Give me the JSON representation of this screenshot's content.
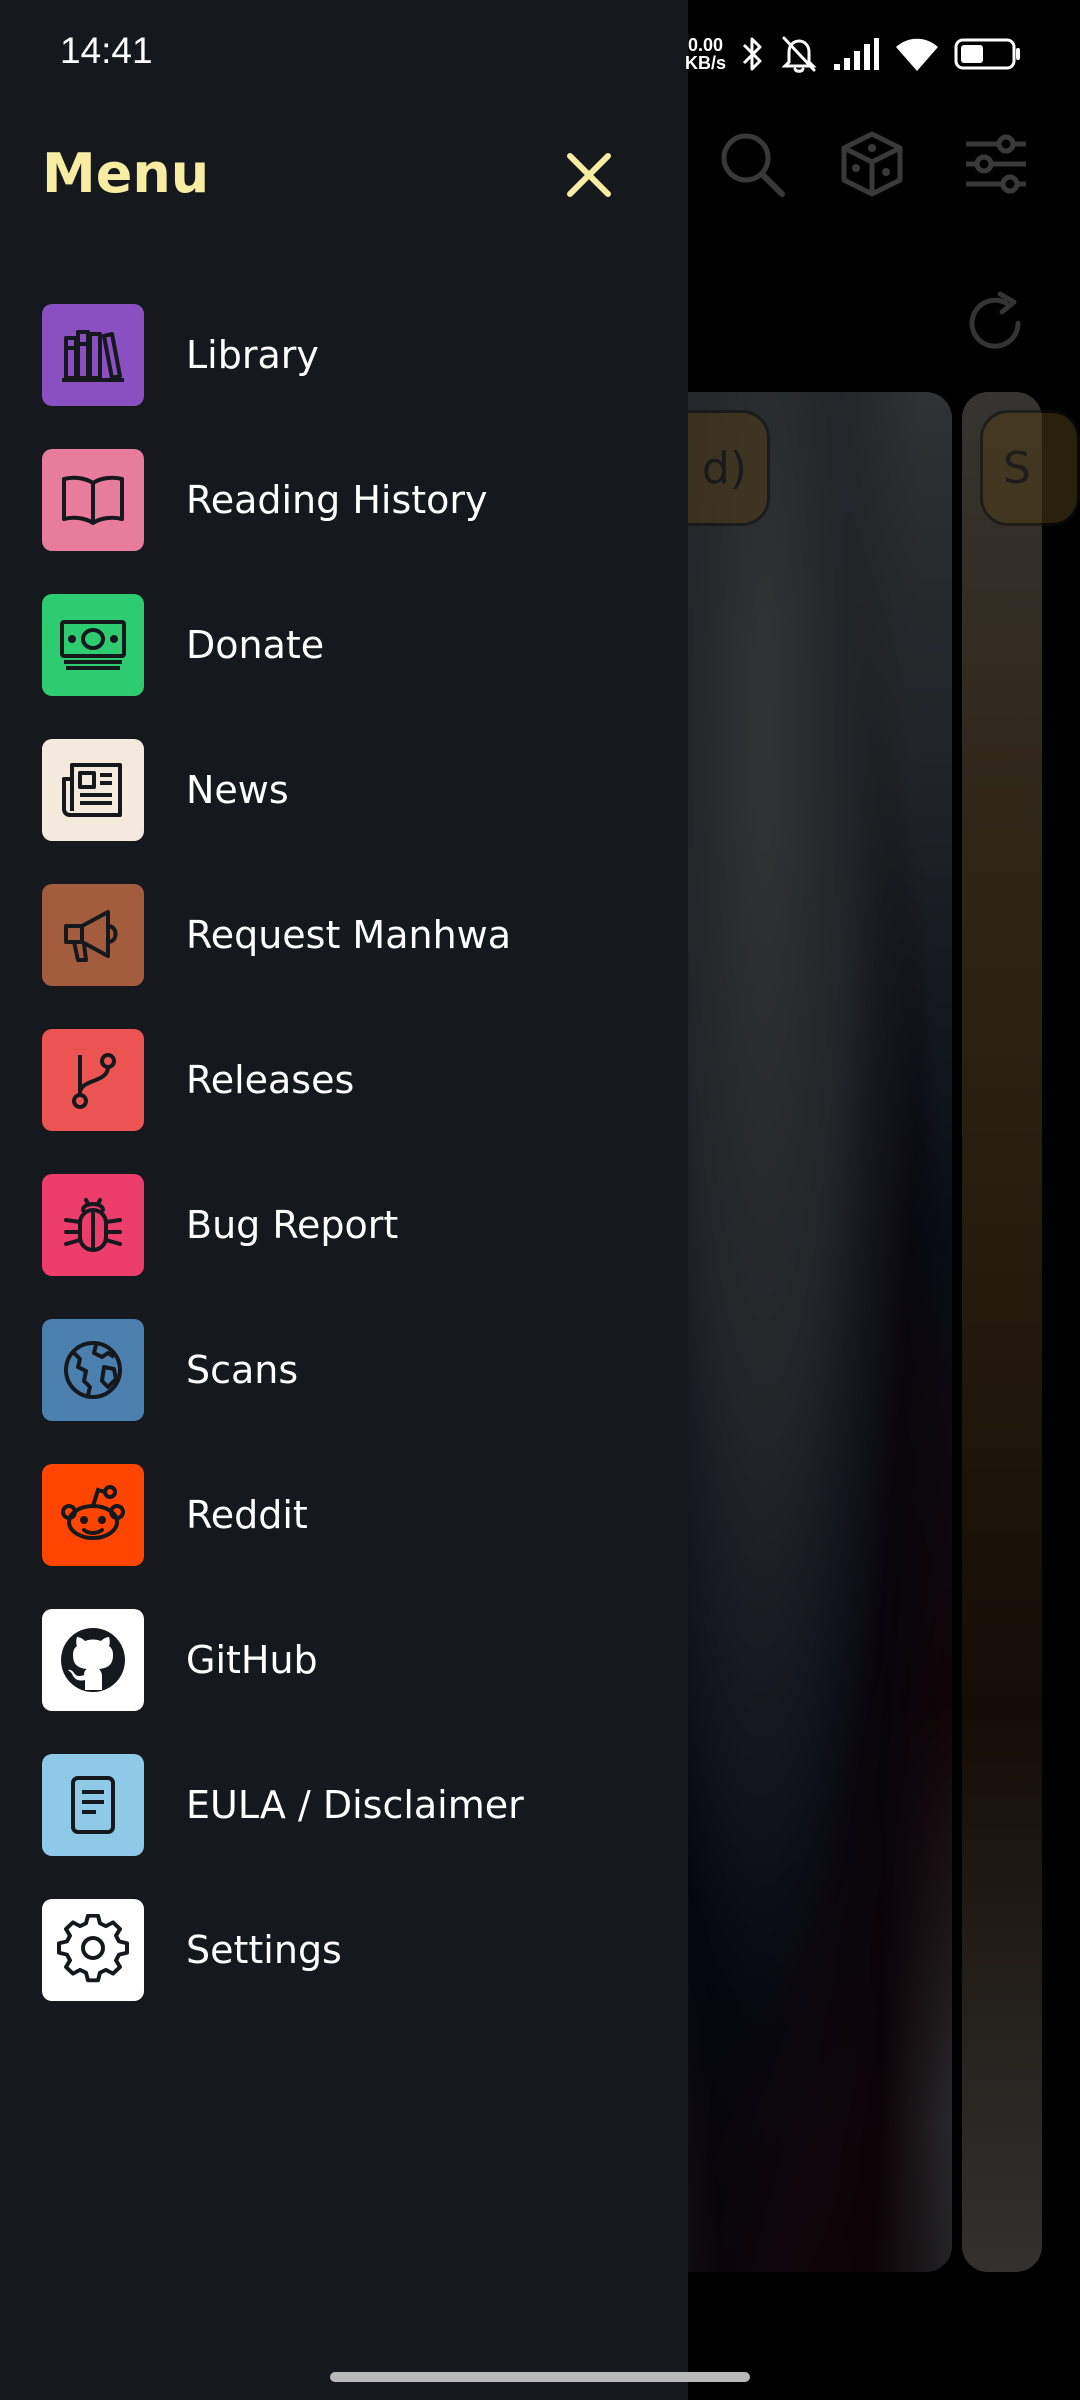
{
  "status_bar": {
    "time": "14:41",
    "net_speed_value": "0.00",
    "net_speed_unit": "KB/s",
    "icons": [
      "bluetooth-icon",
      "notifications-off-icon",
      "signal-icon",
      "wifi-icon",
      "battery-icon"
    ]
  },
  "drawer": {
    "title": "Menu",
    "title_color": "#f6eca2",
    "items": [
      {
        "id": "library",
        "label": "Library",
        "icon": "bookshelf-icon",
        "color": "#8a4fc1"
      },
      {
        "id": "reading-history",
        "label": "Reading History",
        "icon": "open-book-icon",
        "color": "#e77c9c"
      },
      {
        "id": "donate",
        "label": "Donate",
        "icon": "money-icon",
        "color": "#2ecc71"
      },
      {
        "id": "news",
        "label": "News",
        "icon": "newspaper-icon",
        "color": "#f3e9dc"
      },
      {
        "id": "request-manhwa",
        "label": "Request Manhwa",
        "icon": "megaphone-icon",
        "color": "#a35d3e"
      },
      {
        "id": "releases",
        "label": "Releases",
        "icon": "git-branch-icon",
        "color": "#ec5454"
      },
      {
        "id": "bug-report",
        "label": "Bug Report",
        "icon": "bug-icon",
        "color": "#ec3d6c"
      },
      {
        "id": "scans",
        "label": "Scans",
        "icon": "globe-icon",
        "color": "#4a7fae"
      },
      {
        "id": "reddit",
        "label": "Reddit",
        "icon": "reddit-icon",
        "color": "#ff4500"
      },
      {
        "id": "github",
        "label": "GitHub",
        "icon": "github-icon",
        "color": "#ffffff"
      },
      {
        "id": "eula",
        "label": "EULA / Disclaimer",
        "icon": "document-icon",
        "color": "#8fc9e8"
      },
      {
        "id": "settings",
        "label": "Settings",
        "icon": "gear-icon",
        "color": "#ffffff"
      }
    ]
  },
  "background": {
    "toolbar_icons": [
      "search-icon",
      "dice-icon",
      "filter-icon",
      "refresh-icon"
    ],
    "chip_texts": [
      "d)",
      "S"
    ]
  }
}
